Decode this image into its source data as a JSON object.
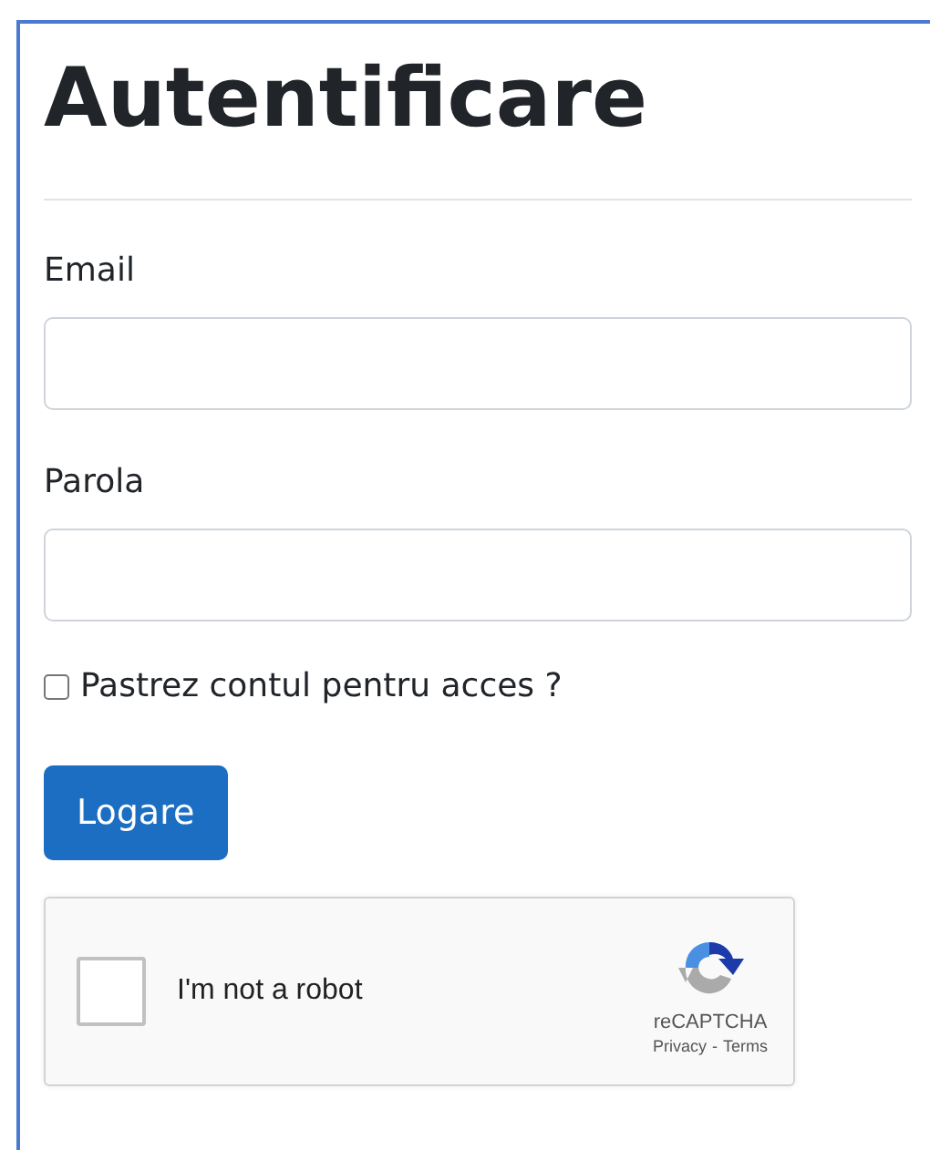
{
  "title": "Autentificare",
  "fields": [
    {
      "label": "Email"
    },
    {
      "label": "Parola"
    }
  ],
  "remember": {
    "label": "Pastrez contul pentru acces ?",
    "checked": false
  },
  "submit": "Logare",
  "captcha": {
    "label": "I'm not a robot",
    "checked": false,
    "brand": "reCAPTCHA",
    "privacy": "Privacy",
    "separator": "-",
    "terms": "Terms"
  }
}
